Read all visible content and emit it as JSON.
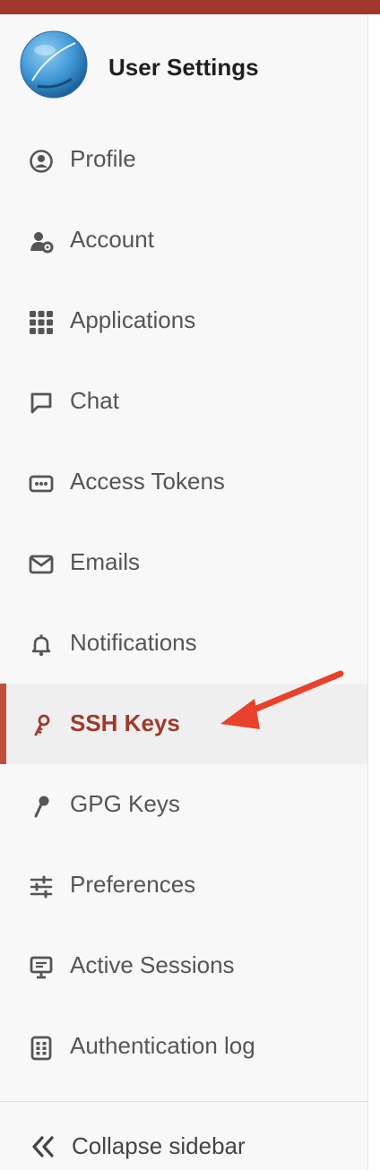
{
  "header": {
    "title": "User Settings"
  },
  "nav": {
    "items": [
      {
        "label": "Profile",
        "icon": "profile-icon"
      },
      {
        "label": "Account",
        "icon": "account-icon"
      },
      {
        "label": "Applications",
        "icon": "applications-icon"
      },
      {
        "label": "Chat",
        "icon": "chat-icon"
      },
      {
        "label": "Access Tokens",
        "icon": "token-icon"
      },
      {
        "label": "Emails",
        "icon": "mail-icon"
      },
      {
        "label": "Notifications",
        "icon": "bell-icon"
      },
      {
        "label": "SSH Keys",
        "icon": "key-icon",
        "active": true
      },
      {
        "label": "GPG Keys",
        "icon": "key-icon"
      },
      {
        "label": "Preferences",
        "icon": "sliders-icon"
      },
      {
        "label": "Active Sessions",
        "icon": "monitor-icon"
      },
      {
        "label": "Authentication log",
        "icon": "log-icon"
      }
    ]
  },
  "footer": {
    "collapse_label": "Collapse sidebar",
    "icon": "chevron-double-left-icon"
  },
  "colors": {
    "accent": "#a0392b",
    "active_bar": "#c14d3b",
    "annotation_arrow": "#e8412c"
  }
}
